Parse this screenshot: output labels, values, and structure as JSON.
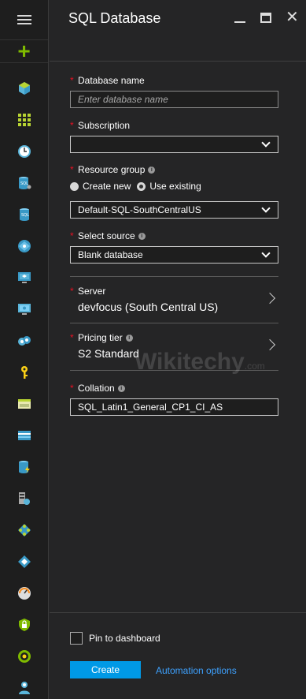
{
  "blade": {
    "title": "SQL Database",
    "minimize_icon": "minimize-icon",
    "maximize_icon": "maximize-icon",
    "close_glyph": "✕"
  },
  "rail": {
    "menu_icon": "hamburger-icon",
    "new_glyph": "+",
    "items": [
      "cube-icon",
      "grid-icon",
      "clock-icon",
      "sql-databases-icon",
      "sql-server-icon",
      "globe-icon",
      "monitor-icon",
      "virtual-machine-icon",
      "cloud-services-icon",
      "key-icon",
      "card-icon",
      "storage-icon",
      "database-lightning-icon",
      "server-cloud-icon",
      "network-icon",
      "diamond-icon",
      "gauge-icon",
      "lock-shield-icon",
      "circle-icon",
      "user-icon"
    ]
  },
  "form": {
    "database_name": {
      "label": "Database name",
      "placeholder": "Enter database name",
      "value": ""
    },
    "subscription": {
      "label": "Subscription",
      "value": ""
    },
    "resource_group": {
      "label": "Resource group",
      "options": [
        "Create new",
        "Use existing"
      ],
      "selected": "Use existing",
      "value": "Default-SQL-SouthCentralUS"
    },
    "select_source": {
      "label": "Select source",
      "value": "Blank database"
    },
    "server": {
      "label": "Server",
      "value": "devfocus (South Central US)"
    },
    "pricing_tier": {
      "label": "Pricing tier",
      "value": "S2 Standard"
    },
    "collation": {
      "label": "Collation",
      "value": "SQL_Latin1_General_CP1_CI_AS"
    },
    "required_mark": "*",
    "info_glyph": "i"
  },
  "watermark": {
    "text": "Wikitechy",
    "suffix": ".com"
  },
  "footer": {
    "pin_label": "Pin to dashboard",
    "create_label": "Create",
    "automation_label": "Automation options"
  },
  "colors": {
    "accent": "#0099e6",
    "link": "#3ea2ff",
    "required": "#e81123",
    "new": "#7fba00"
  }
}
